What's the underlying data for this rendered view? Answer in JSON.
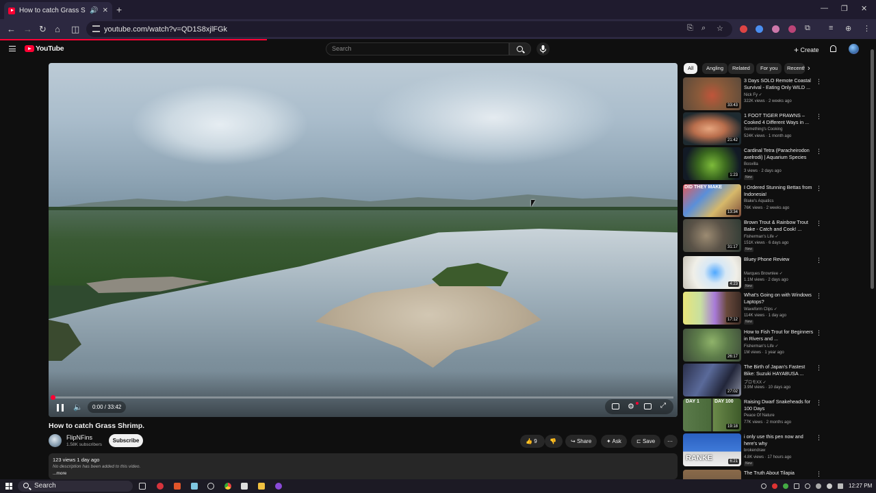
{
  "browser": {
    "tab_title": "How to catch Grass Shrimp",
    "url": "youtube.com/watch?v=QD1S8xjlFGk"
  },
  "header": {
    "logo_text": "YouTube",
    "search_placeholder": "Search",
    "create_label": "Create"
  },
  "player": {
    "time": "0:00 / 33:42",
    "progress_fraction": 0.0
  },
  "video": {
    "title": "How to catch Grass Shrimp.",
    "channel": "FlipNFins",
    "subscribers": "1.58K subscribers",
    "subscribe_label": "Subscribe",
    "likes": "9",
    "share_label": "Share",
    "ask_label": "Ask",
    "save_label": "Save",
    "stats": "123 views  1 day ago",
    "description": "No description has been added to this video.",
    "more_label": "...more"
  },
  "chips": [
    "All",
    "Angling",
    "Related",
    "For you",
    "Recently uploaded"
  ],
  "sidebar": {
    "items": [
      {
        "title": "3 Days SOLO Remote Coastal Survival - Eating Only WILD ...",
        "channel": "Nick Fy ✓",
        "meta": "322K views · 2 weeks ago",
        "duration": "33:43",
        "new": ""
      },
      {
        "title": "1 FOOT TIGER PRAWNS – Cooked 4 Different Ways in ...",
        "channel": "Something's Cooking",
        "meta": "524K views · 1 month ago",
        "duration": "21:42",
        "new": ""
      },
      {
        "title": "Cardinal Tetra (Paracheirodon axelrodi) | Aquarium Species",
        "channel": "Bosvilla",
        "meta": "3 views · 2 days ago",
        "duration": "1:23",
        "new": "New"
      },
      {
        "title": "I Ordered Stunning Bettas from Indonesia!",
        "channel": "Blake's Aquatics",
        "meta": "76K views · 2 weeks ago",
        "duration": "13:34",
        "new": ""
      },
      {
        "title": "Brown Trout & Rainbow Trout Bake - Catch and Cook! ...",
        "channel": "Fisherman's Life ✓",
        "meta": "151K views · 6 days ago",
        "duration": "31:17",
        "new": "New"
      },
      {
        "title": "Bluey Phone Review",
        "channel": "Marques Brownlee ✓",
        "meta": "1.1M views · 2 days ago",
        "duration": "4:23",
        "new": "New"
      },
      {
        "title": "What's Going on with Windows Laptops?",
        "channel": "Waveform Clips ✓",
        "meta": "114K views · 1 day ago",
        "duration": "17:12",
        "new": "New"
      },
      {
        "title": "How to Fish Trout for Beginners in Rivers and ...",
        "channel": "Fisherman's Life ✓",
        "meta": "1M views · 1 year ago",
        "duration": "26:17",
        "new": ""
      },
      {
        "title": "The Birth of Japan's Fastest Bike: Suzuki HAYABUSA ...",
        "channel": "プロモXX ✓",
        "meta": "3.9M views · 10 days ago",
        "duration": "27:02",
        "new": ""
      },
      {
        "title": "Raising Dwarf Snakeheads for 100 Days",
        "channel": "Peace Of Nature",
        "meta": "77K views · 2 months ago",
        "duration": "19:18",
        "new": ""
      },
      {
        "title": "i only use this pen now and here's why",
        "channel": "brokendraw",
        "meta": "4.8K views · 17 hours ago",
        "duration": "6:21",
        "new": "New"
      },
      {
        "title": "The Truth About Tilapia",
        "channel": "",
        "meta": "",
        "duration": "",
        "new": ""
      }
    ],
    "thumb_labels": {
      "t4": "DID THEY MAKE",
      "t10a": "DAY 1",
      "t10b": "DAY 100",
      "t11": "RANKE"
    }
  },
  "taskbar": {
    "search_label": "Search",
    "clock": "12:27 PM"
  },
  "colors": {
    "accent": "#ff0033",
    "background": "#0f0f0f",
    "surface": "#272727"
  }
}
